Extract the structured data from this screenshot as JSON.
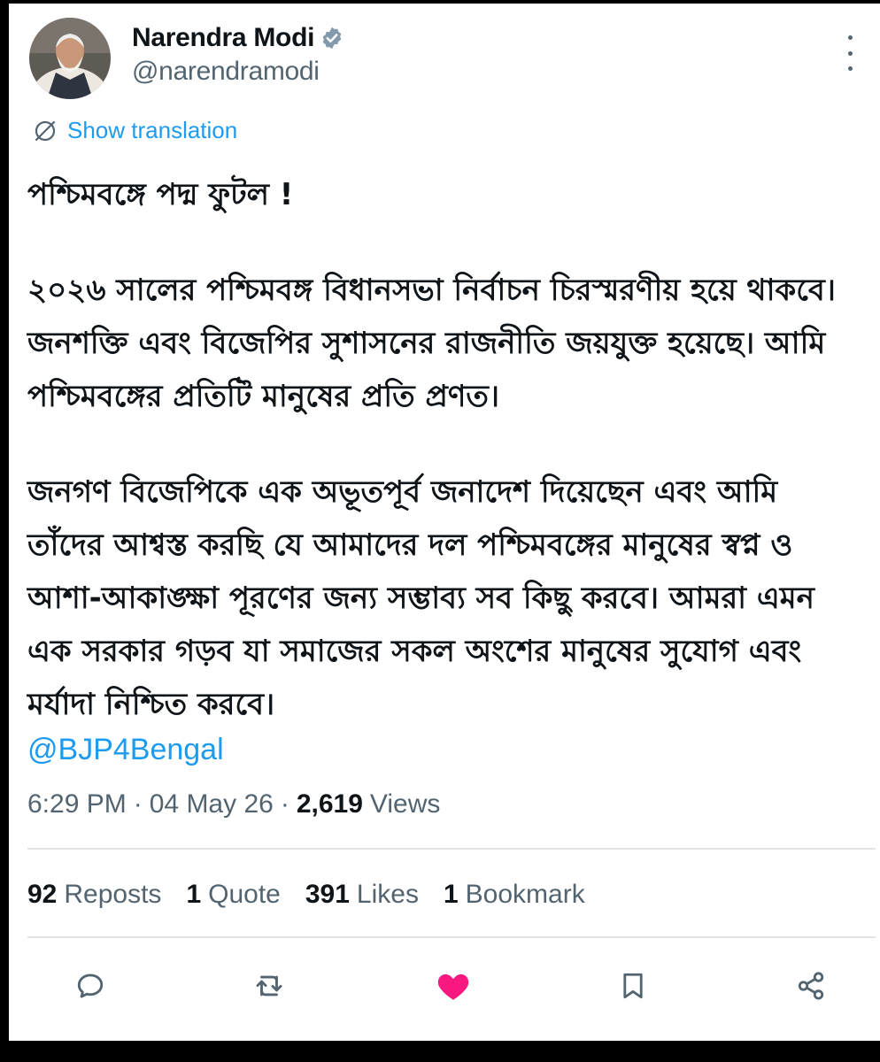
{
  "author": {
    "display_name": "Narendra Modi",
    "handle": "@narendramodi",
    "verified": true
  },
  "translation": {
    "label": "Show translation"
  },
  "tweet": {
    "paragraphs": [
      "পশ্চিমবঙ্গে পদ্ম ফুটল !",
      "২০২৬ সালের পশ্চিমবঙ্গ বিধানসভা নির্বাচন চিরস্মরণীয় হয়ে থাকবে। জনশক্তি এবং বিজেপির সুশাসনের রাজনীতি জয়যুক্ত হয়েছে। আমি পশ্চিমবঙ্গের প্রতিটি মানুষের প্রতি প্রণত।",
      "জনগণ বিজেপিকে এক অভূতপূর্ব জনাদেশ দিয়েছেন এবং আমি তাঁদের আশ্বস্ত করছি যে আমাদের দল পশ্চিমবঙ্গের মানুষের স্বপ্ন ও আশা-আকাঙ্ক্ষা পূরণের জন্য সম্ভাব্য সব কিছু করবে। আমরা এমন এক সরকার গড়ব যা সমাজের সকল অংশের মানুষের সুযোগ এবং মর্যাদা নিশ্চিত করবে।"
    ],
    "mention": "@BJP4Bengal"
  },
  "meta": {
    "time": "6:29 PM",
    "date": "04 May 26",
    "separator": "·",
    "views_count": "2,619",
    "views_label": "Views"
  },
  "stats": {
    "reposts_count": "92",
    "reposts_label": "Reposts",
    "quotes_count": "1",
    "quotes_label": "Quote",
    "likes_count": "391",
    "likes_label": "Likes",
    "bookmarks_count": "1",
    "bookmarks_label": "Bookmark"
  },
  "colors": {
    "accent": "#1d9bf0",
    "like_active": "#f91880",
    "secondary_text": "#536471",
    "primary_text": "#0f1419"
  },
  "icons": {
    "verified": "verified-badge-icon",
    "more": "more-options-icon",
    "translate": "globe-translate-icon",
    "reply": "reply-icon",
    "repost": "repost-icon",
    "like": "heart-filled-icon",
    "bookmark": "bookmark-icon",
    "share": "share-icon"
  }
}
